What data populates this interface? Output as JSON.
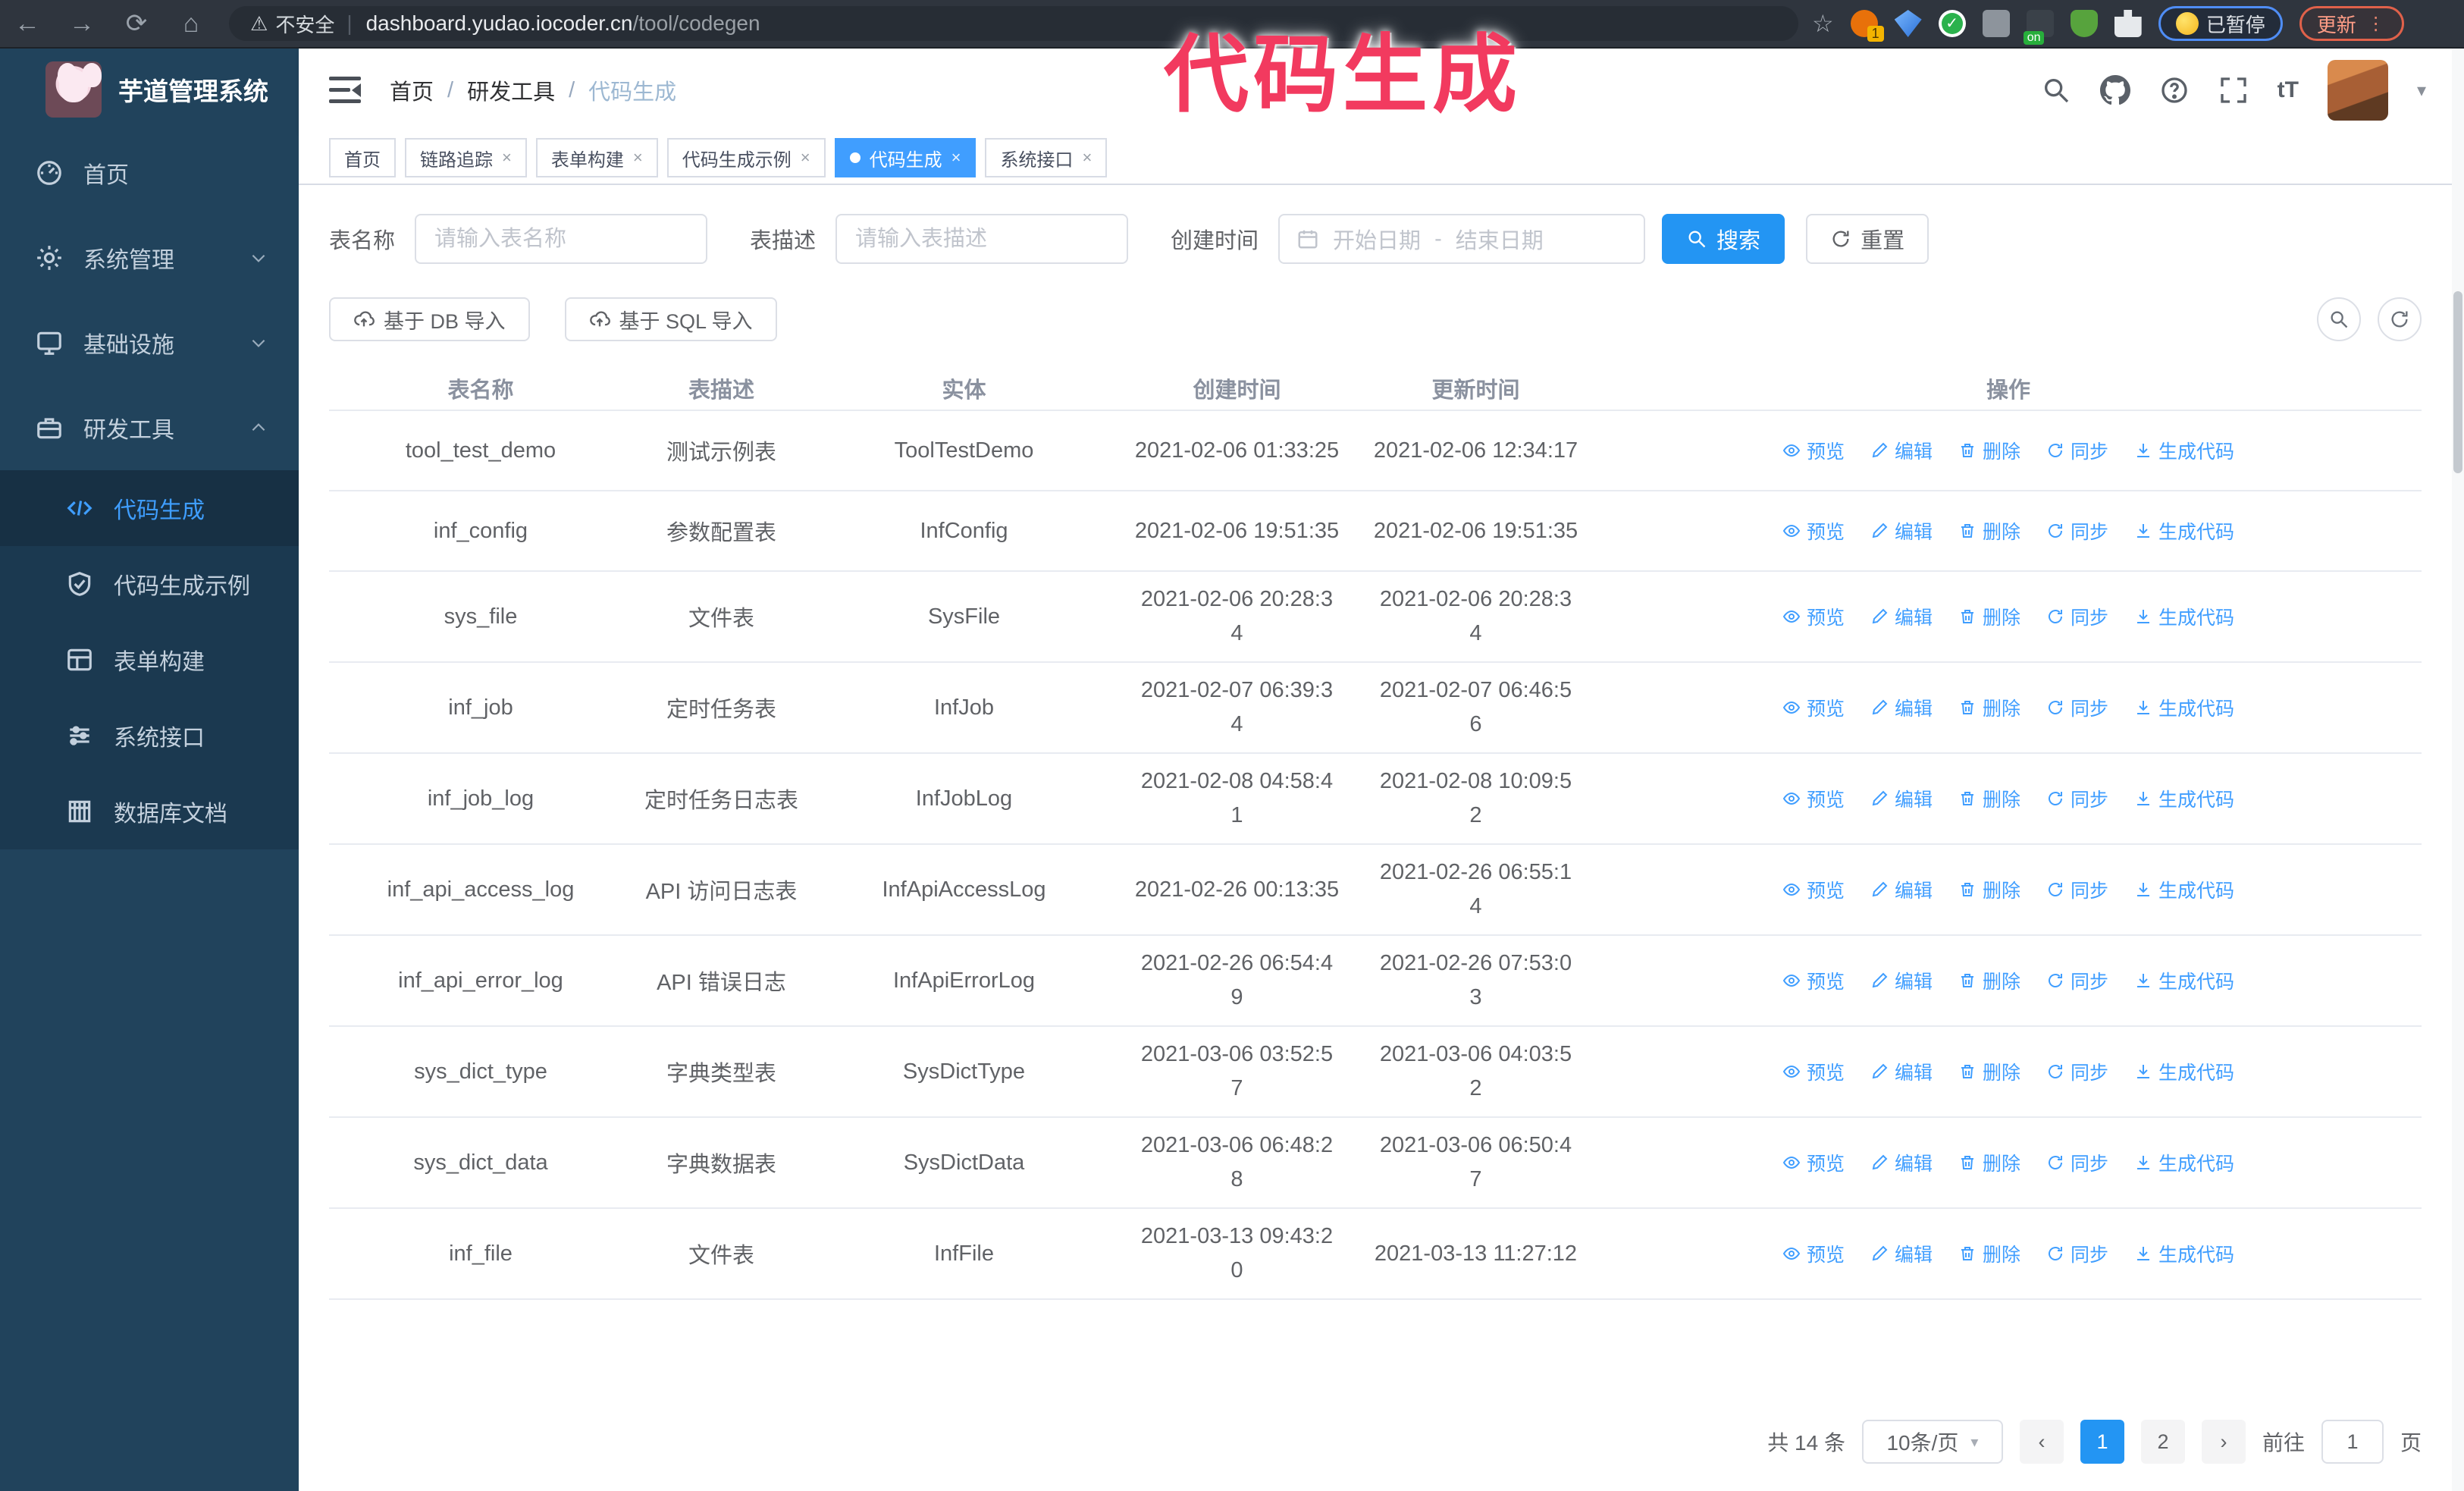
{
  "browser": {
    "security_label": "不安全",
    "url_host": "dashboard.yudao.iocoder.cn",
    "url_path": "/tool/codegen",
    "paused_label": "已暂停",
    "update_label": "更新"
  },
  "overlay": {
    "annotation": "代码生成",
    "color": "#f23a5f"
  },
  "sidebar": {
    "title": "芋道管理系统",
    "items": [
      {
        "label": "首页"
      },
      {
        "label": "系统管理"
      },
      {
        "label": "基础设施"
      },
      {
        "label": "研发工具"
      }
    ],
    "subitems": [
      {
        "label": "代码生成"
      },
      {
        "label": "代码生成示例"
      },
      {
        "label": "表单构建"
      },
      {
        "label": "系统接口"
      },
      {
        "label": "数据库文档"
      }
    ]
  },
  "header": {
    "breadcrumb": {
      "home": "首页",
      "group": "研发工具",
      "current": "代码生成"
    }
  },
  "tabs": [
    {
      "label": "首页"
    },
    {
      "label": "链路追踪"
    },
    {
      "label": "表单构建"
    },
    {
      "label": "代码生成示例"
    },
    {
      "label": "代码生成"
    },
    {
      "label": "系统接口"
    }
  ],
  "filters": {
    "table_name_label": "表名称",
    "table_name_placeholder": "请输入表名称",
    "table_desc_label": "表描述",
    "table_desc_placeholder": "请输入表描述",
    "create_time_label": "创建时间",
    "start_placeholder": "开始日期",
    "range_separator": "-",
    "end_placeholder": "结束日期",
    "search_label": "搜索",
    "reset_label": "重置"
  },
  "toolbar": {
    "import_db_label": "基于 DB 导入",
    "import_sql_label": "基于 SQL 导入"
  },
  "table": {
    "columns": [
      "表名称",
      "表描述",
      "实体",
      "创建时间",
      "更新时间",
      "操作"
    ],
    "actions": [
      "预览",
      "编辑",
      "删除",
      "同步",
      "生成代码"
    ],
    "rows": [
      {
        "name": "tool_test_demo",
        "desc": "测试示例表",
        "entity": "ToolTestDemo",
        "created": "2021-02-06 01:33:25",
        "updated": "2021-02-06 12:34:17"
      },
      {
        "name": "inf_config",
        "desc": "参数配置表",
        "entity": "InfConfig",
        "created": "2021-02-06 19:51:35",
        "updated": "2021-02-06 19:51:35"
      },
      {
        "name": "sys_file",
        "desc": "文件表",
        "entity": "SysFile",
        "created": "2021-02-06 20:28:3\n4",
        "updated": "2021-02-06 20:28:3\n4"
      },
      {
        "name": "inf_job",
        "desc": "定时任务表",
        "entity": "InfJob",
        "created": "2021-02-07 06:39:3\n4",
        "updated": "2021-02-07 06:46:5\n6"
      },
      {
        "name": "inf_job_log",
        "desc": "定时任务日志表",
        "entity": "InfJobLog",
        "created": "2021-02-08 04:58:4\n1",
        "updated": "2021-02-08 10:09:5\n2"
      },
      {
        "name": "inf_api_access_log",
        "desc": "API 访问日志表",
        "entity": "InfApiAccessLog",
        "created": "2021-02-26 00:13:35",
        "updated": "2021-02-26 06:55:1\n4"
      },
      {
        "name": "inf_api_error_log",
        "desc": "API 错误日志",
        "entity": "InfApiErrorLog",
        "created": "2021-02-26 06:54:4\n9",
        "updated": "2021-02-26 07:53:0\n3"
      },
      {
        "name": "sys_dict_type",
        "desc": "字典类型表",
        "entity": "SysDictType",
        "created": "2021-03-06 03:52:5\n7",
        "updated": "2021-03-06 04:03:5\n2"
      },
      {
        "name": "sys_dict_data",
        "desc": "字典数据表",
        "entity": "SysDictData",
        "created": "2021-03-06 06:48:2\n8",
        "updated": "2021-03-06 06:50:4\n7"
      },
      {
        "name": "inf_file",
        "desc": "文件表",
        "entity": "InfFile",
        "created": "2021-03-13 09:43:2\n0",
        "updated": "2021-03-13 11:27:12"
      }
    ]
  },
  "pagination": {
    "total_label": "共 14 条",
    "page_size_label": "10条/页",
    "pages": [
      "1",
      "2"
    ],
    "goto_label": "前往",
    "goto_value": "1",
    "page_suffix_label": "页"
  }
}
